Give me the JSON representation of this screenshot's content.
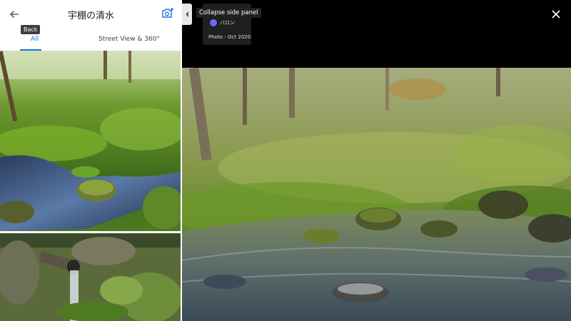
{
  "panel": {
    "title": "宇棚の清水",
    "back_tooltip": "Back",
    "tabs": [
      {
        "label": "All",
        "active": true
      },
      {
        "label": "Street View & 360°",
        "active": false
      }
    ],
    "icons": {
      "back": "arrow-left-icon",
      "add_photo": "add-photo-icon"
    }
  },
  "viewer": {
    "collapse_tooltip": "Collapse side panel",
    "author": "バロン",
    "photo_date": "Photo - Oct 2020",
    "icons": {
      "close": "close-icon",
      "collapse": "chevron-left-icon"
    }
  },
  "colors": {
    "accent": "#1a73e8",
    "tooltip_bg": "#202124"
  }
}
